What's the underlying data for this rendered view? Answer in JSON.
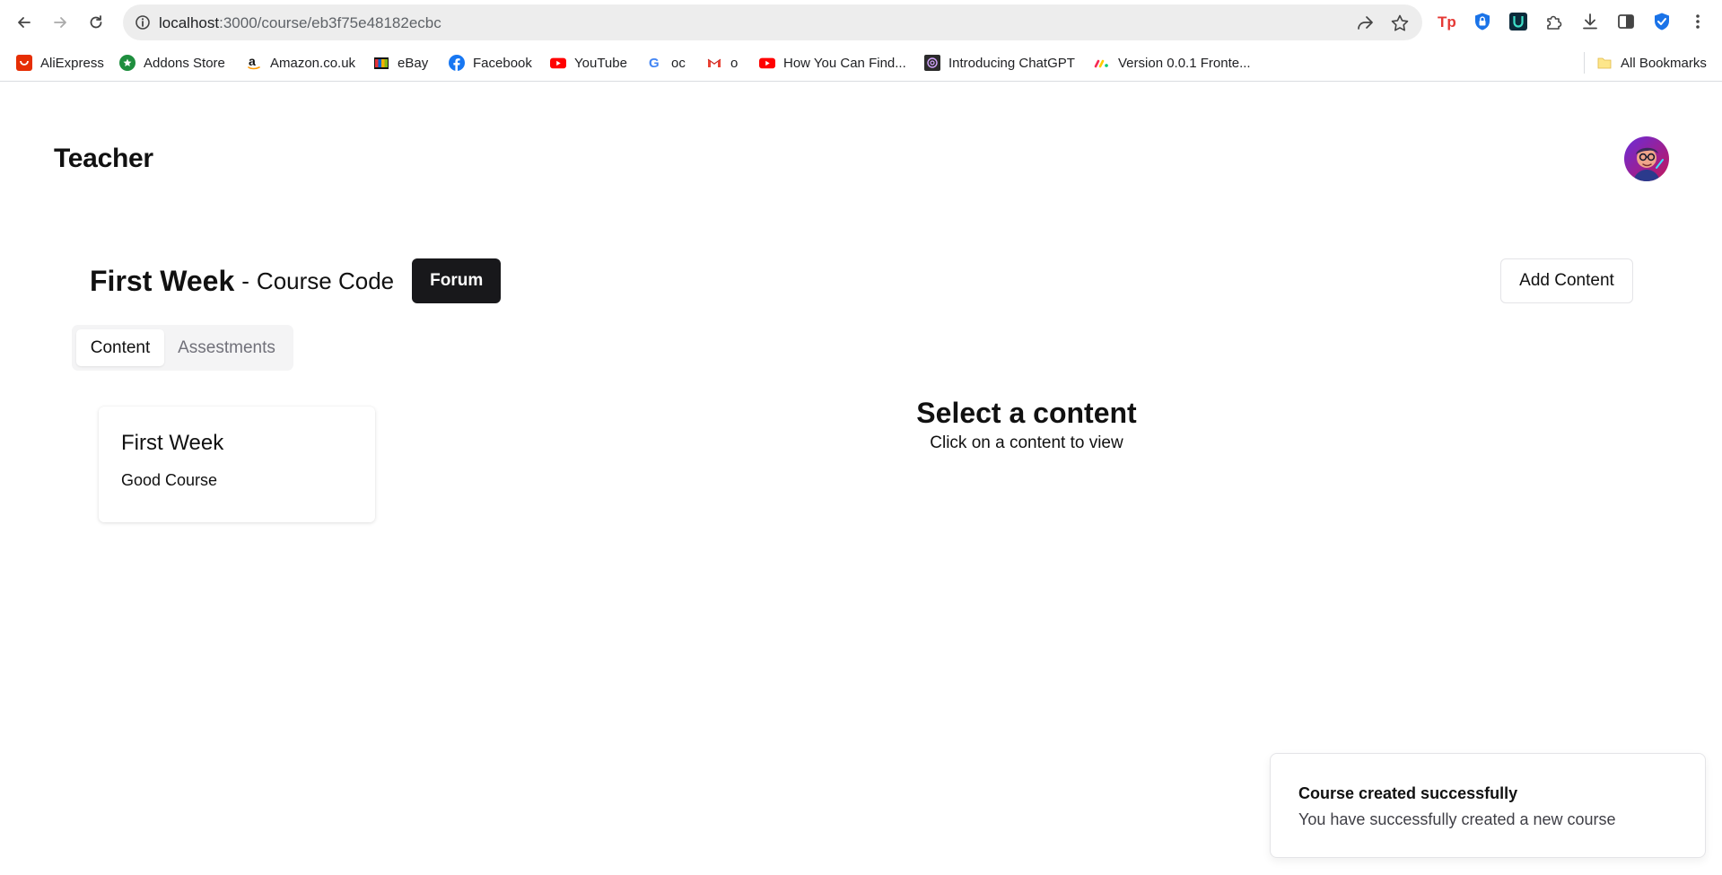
{
  "browser": {
    "url_host": "localhost",
    "url_path": ":3000/course/eb3f75e48182ecbc",
    "bookmarks": [
      {
        "label": "AliExpress",
        "icon": "aliexpress-icon"
      },
      {
        "label": "Addons Store",
        "icon": "addons-store-icon"
      },
      {
        "label": "Amazon.co.uk",
        "icon": "amazon-icon"
      },
      {
        "label": "eBay",
        "icon": "ebay-icon"
      },
      {
        "label": "Facebook",
        "icon": "facebook-icon"
      },
      {
        "label": "YouTube",
        "icon": "youtube-icon"
      },
      {
        "label": "oc",
        "icon": "google-icon"
      },
      {
        "label": "o",
        "icon": "gmail-icon"
      },
      {
        "label": "How You Can Find...",
        "icon": "youtube-icon"
      },
      {
        "label": "Introducing ChatGPT",
        "icon": "chatgpt-icon"
      },
      {
        "label": "Version 0.0.1 Fronte...",
        "icon": "monday-icon"
      }
    ],
    "all_bookmarks_label": "All Bookmarks"
  },
  "app": {
    "title": "Teacher"
  },
  "course": {
    "name": "First Week",
    "dash": "-",
    "code_label": "Course Code",
    "forum_label": "Forum",
    "add_content_label": "Add Content"
  },
  "tabs": [
    {
      "label": "Content",
      "active": true
    },
    {
      "label": "Assestments",
      "active": false
    }
  ],
  "contents": [
    {
      "title": "First Week",
      "description": "Good Course"
    }
  ],
  "empty_state": {
    "title": "Select a content",
    "subtitle": "Click on a content to view"
  },
  "toast": {
    "title": "Course created successfully",
    "description": "You have successfully created a new course"
  },
  "colors": {
    "primary_button": "#18181b",
    "tab_background": "#f4f4f5",
    "muted_text": "#71717a"
  }
}
